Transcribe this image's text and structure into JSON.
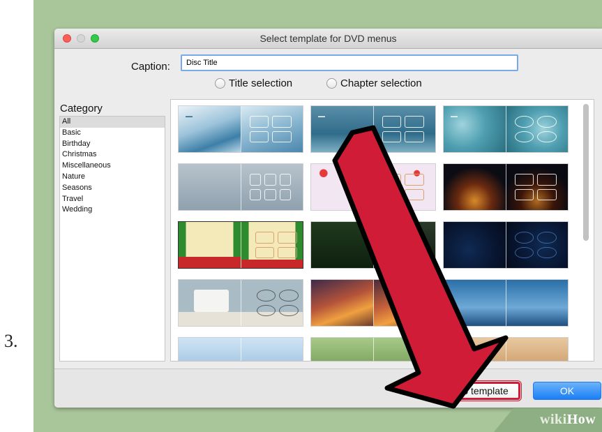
{
  "step_number": "3.",
  "window": {
    "title": "Select template for DVD menus"
  },
  "caption": {
    "label": "Caption:",
    "value": "Disc Title"
  },
  "radios": {
    "title_selection": "Title selection",
    "chapter_selection": "Chapter selection"
  },
  "category": {
    "heading": "Category",
    "items": [
      "All",
      "Basic",
      "Birthday",
      "Christmas",
      "Miscellaneous",
      "Nature",
      "Seasons",
      "Travel",
      "Wedding"
    ],
    "selected": "All"
  },
  "buttons": {
    "no_template": "No template",
    "ok": "OK"
  },
  "watermark": {
    "part1": "wiki",
    "part2": "How"
  },
  "colors": {
    "highlight_red": "#d11c37",
    "ok_blue": "#1a7ef6",
    "frame_green": "#a9c59a"
  }
}
